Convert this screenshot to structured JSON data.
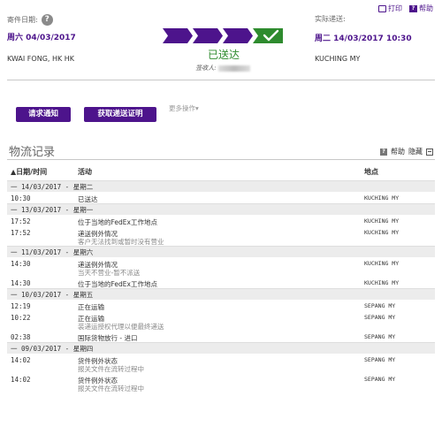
{
  "top_links": {
    "print": "打印",
    "help": "帮助"
  },
  "ship_from": {
    "label": "寄件日期:",
    "date": "周六 04/03/2017",
    "location": "KWAI FONG, HK HK"
  },
  "ship_to": {
    "label": "实际递送:",
    "date": "周二 14/03/2017 10:30",
    "location": "KUCHING MY"
  },
  "progress": {
    "steps_total": 4,
    "steps_completed": 4
  },
  "status": {
    "text": "已送达",
    "signer_label": "签收人:"
  },
  "buttons": {
    "request_notify": "请求通知",
    "get_proof": "获取递送证明",
    "more_ops": "更多操作▾"
  },
  "history": {
    "title": "物流记录",
    "help": "帮助",
    "hide": "隐藏",
    "col_date": "▲日期/时间",
    "col_activity": "活动",
    "col_location": "地点"
  },
  "colors": {
    "accent": "#4d148c",
    "delivered": "#2e8b2e"
  },
  "days": [
    {
      "label": "一  14/03/2017 - 星期二",
      "events": [
        {
          "time": "10:30",
          "activity": "已送达",
          "sub": "",
          "location": "KUCHING MY"
        }
      ]
    },
    {
      "label": "一  13/03/2017 - 星期一",
      "events": [
        {
          "time": "17:52",
          "activity": "位于当地的FedEx工作地点",
          "sub": "",
          "location": "KUCHING MY"
        },
        {
          "time": "17:52",
          "activity": "递送例外情况",
          "sub": "客户无法找到或暂时没有营业",
          "location": "KUCHING MY"
        }
      ]
    },
    {
      "label": "一  11/03/2017 - 星期六",
      "events": [
        {
          "time": "14:30",
          "activity": "递送例外情况",
          "sub": "当天不营业-暂不派送",
          "location": "KUCHING MY"
        },
        {
          "time": "14:30",
          "activity": "位于当地的FedEx工作地点",
          "sub": "",
          "location": "KUCHING MY"
        }
      ]
    },
    {
      "label": "一  10/03/2017 - 星期五",
      "events": [
        {
          "time": "12:19",
          "activity": "正在运输",
          "sub": "",
          "location": "SEPANG MY"
        },
        {
          "time": "10:22",
          "activity": "正在运输",
          "sub": "装递运授权代理以便最终递送",
          "location": "SEPANG MY"
        },
        {
          "time": "02:38",
          "activity": "国际货物放行 - 进口",
          "sub": "",
          "location": "SEPANG MY"
        }
      ]
    },
    {
      "label": "一  09/03/2017 - 星期四",
      "events": [
        {
          "time": "14:02",
          "activity": "货件例外状态",
          "sub": "报关文件在流转过程中",
          "location": "SEPANG MY"
        },
        {
          "time": "14:02",
          "activity": "货件例外状态",
          "sub": "报关文件在流转过程中",
          "location": "SEPANG MY"
        }
      ]
    }
  ]
}
